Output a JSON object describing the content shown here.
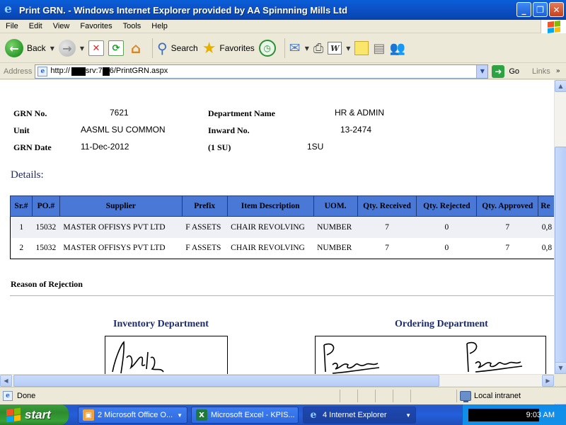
{
  "window": {
    "title": "Print GRN. - Windows Internet Explorer provided by AA Spinnning Mills Ltd",
    "buttons": [
      "_",
      "❐",
      "✕"
    ]
  },
  "menu": [
    "File",
    "Edit",
    "View",
    "Favorites",
    "Tools",
    "Help"
  ],
  "toolbar": {
    "back_label": "Back",
    "search_label": "Search",
    "favorites_label": "Favorites"
  },
  "address": {
    "label": "Address",
    "url_prefix": "http://",
    "url_mid": "srv:7",
    "url_suffix": "6/PrintGRN.aspx",
    "go_label": "Go",
    "links_label": "Links"
  },
  "grn": {
    "grn_no_label": "GRN No.",
    "grn_no": "7621",
    "unit_label": "Unit",
    "unit": "AASML SU COMMON",
    "grn_date_label": "GRN Date",
    "grn_date": "11-Dec-2012",
    "department_label": "Department Name",
    "department": "HR & ADMIN",
    "inward_label": "Inward No.",
    "inward": "13-2474",
    "su_label": "(1 SU)",
    "su": "1SU"
  },
  "details_heading": "Details:",
  "table": {
    "headers": [
      "Sr.#",
      "PO.#",
      "Supplier",
      "Prefix",
      "Item Description",
      "UOM.",
      "Qty. Received",
      "Qty. Rejected",
      "Qty. Approved",
      "Re"
    ],
    "rows": [
      [
        "1",
        "15032",
        "MASTER OFFISYS PVT LTD",
        "F ASSETS",
        "CHAIR REVOLVING",
        "NUMBER",
        "7",
        "0",
        "7",
        "0,8"
      ],
      [
        "2",
        "15032",
        "MASTER OFFISYS PVT LTD",
        "F ASSETS",
        "CHAIR REVOLVING",
        "NUMBER",
        "7",
        "0",
        "7",
        "0,8"
      ]
    ]
  },
  "reason_label": "Reason of Rejection",
  "signatures": {
    "inventory": "Inventory Department",
    "ordering": "Ordering Department"
  },
  "status": {
    "text": "Done",
    "zone": "Local intranet"
  },
  "taskbar": {
    "start": "start",
    "tasks": [
      "2 Microsoft Office O...",
      "Microsoft Excel - KPIS...",
      "4 Internet Explorer"
    ],
    "time": "9:03 AM"
  },
  "colors": {
    "titlebar": "#0a5fd8",
    "table_header": "#4a78d6",
    "heading_navy": "#1c2a6e",
    "taskbar": "#245edb",
    "start_green": "#37a237"
  },
  "icons": [
    "ie-icon",
    "back-icon",
    "forward-icon",
    "stop-icon",
    "refresh-icon",
    "home-icon",
    "search-icon",
    "favorites-star-icon",
    "history-icon",
    "mail-icon",
    "print-icon",
    "edit-word-icon",
    "note-icon",
    "research-icon",
    "messenger-icon",
    "go-arrow-icon",
    "windows-flag-icon",
    "intranet-icon"
  ]
}
